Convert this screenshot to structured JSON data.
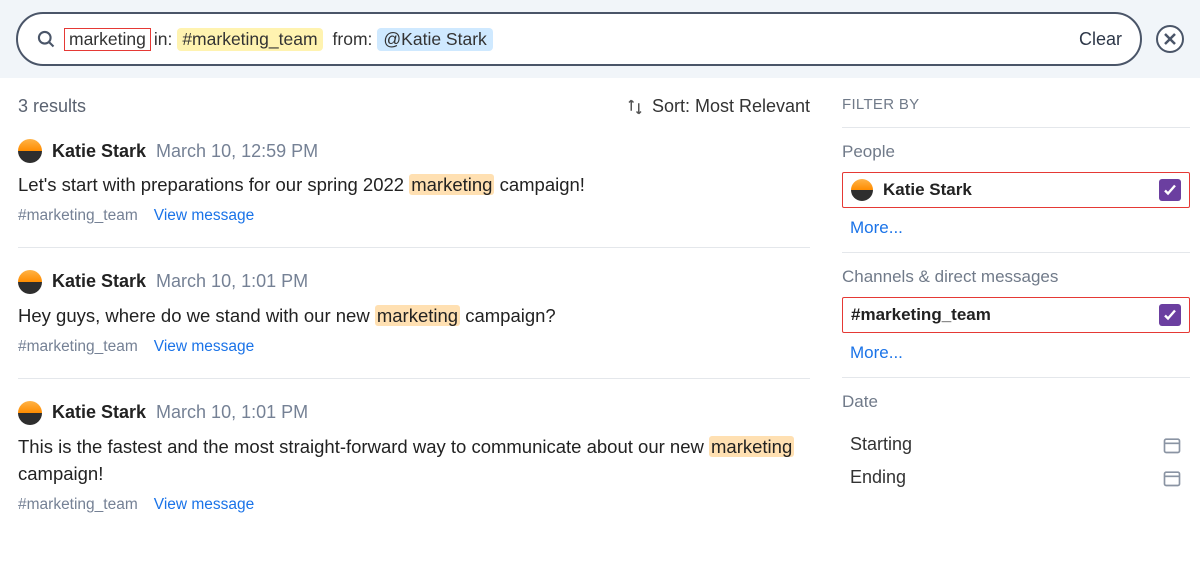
{
  "search": {
    "term": "marketing",
    "in_label": "in:",
    "channel_token": "#marketing_team",
    "from_label": "from:",
    "user_token": "@Katie Stark",
    "clear_label": "Clear"
  },
  "results": {
    "count_label": "3 results",
    "sort_label": "Sort: Most Relevant",
    "items": [
      {
        "name": "Katie Stark",
        "time": "March 10, 12:59 PM",
        "text_before": "Let's start with preparations for our spring 2022 ",
        "highlight": "marketing",
        "text_after": " campaign!",
        "channel": "#marketing_team",
        "view": "View message"
      },
      {
        "name": "Katie Stark",
        "time": "March 10, 1:01 PM",
        "text_before": "Hey guys, where do we stand with our new ",
        "highlight": "marketing",
        "text_after": " campaign?",
        "channel": "#marketing_team",
        "view": "View message"
      },
      {
        "name": "Katie Stark",
        "time": "March 10, 1:01 PM",
        "text_before": "This is the fastest and the most straight-forward way to communicate about our new ",
        "highlight": "marketing",
        "text_after": " campaign!",
        "channel": "#marketing_team",
        "view": "View message"
      }
    ]
  },
  "filters": {
    "title": "FILTER BY",
    "people_label": "People",
    "people_item": "Katie Stark",
    "channels_label": "Channels & direct messages",
    "channels_item": "#marketing_team",
    "more_label": "More...",
    "date_label": "Date",
    "starting_label": "Starting",
    "ending_label": "Ending"
  }
}
